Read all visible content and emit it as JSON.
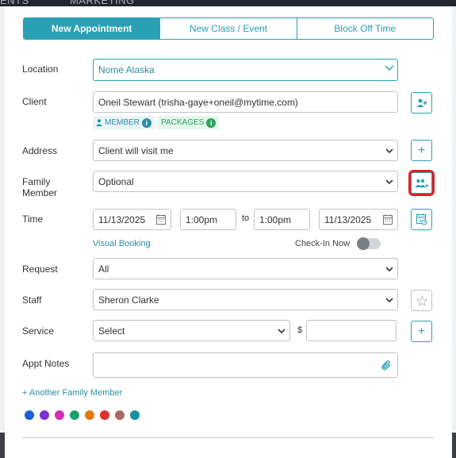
{
  "background": {
    "nav_fragment_1": "ENTS",
    "nav_fragment_2": "MARKETING"
  },
  "tabs": [
    {
      "label": "New Appointment",
      "active": true
    },
    {
      "label": "New Class / Event",
      "active": false
    },
    {
      "label": "Block Off Time",
      "active": false
    }
  ],
  "location": {
    "label": "Location",
    "value": "Nome Alaska"
  },
  "client": {
    "label": "Client",
    "value": "Oneil Stewart (trisha-gaye+oneil@mytime.com)",
    "member_tag": "MEMBER",
    "packages_tag": "PACKAGES",
    "info_glyph": "i"
  },
  "address": {
    "label": "Address",
    "value": "Client will visit me"
  },
  "family_member": {
    "label_line1": "Family",
    "label_line2": "Member",
    "value": "Optional"
  },
  "time": {
    "label": "Time",
    "start_date": "11/13/2025",
    "start_time": "1:00pm",
    "to": "to",
    "end_time": "1:00pm",
    "end_date": "11/13/2025",
    "visual_booking": "Visual Booking",
    "check_in_now": "Check-In Now",
    "check_in_enabled": false
  },
  "request": {
    "label": "Request",
    "value": "All"
  },
  "staff": {
    "label": "Staff",
    "value": "Sheron Clarke"
  },
  "service": {
    "label": "Service",
    "value": "Select",
    "currency": "$",
    "price": ""
  },
  "appt_notes": {
    "label": "Appt Notes",
    "value": ""
  },
  "another_family_member": "+ Another Family Member",
  "plus_glyph": "+",
  "colors": [
    "#1a5fd6",
    "#7b2fd6",
    "#d12fb0",
    "#1f9e6b",
    "#e07a12",
    "#e03131",
    "#a66b5f",
    "#14919b"
  ],
  "accent_color": "#2aa0b4"
}
